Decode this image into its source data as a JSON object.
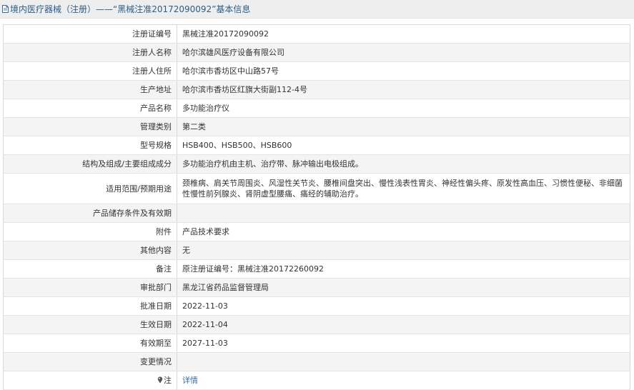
{
  "header": {
    "title": "境内医疗器械（注册）——“黑械注准20172090092”基本信息",
    "icon": "document-icon"
  },
  "rows": [
    {
      "label": "注册证编号",
      "value": "黑械注准20172090092"
    },
    {
      "label": "注册人名称",
      "value": "哈尔滨雄风医疗设备有限公司"
    },
    {
      "label": "注册人住所",
      "value": "哈尔滨市香坊区中山路57号"
    },
    {
      "label": "生产地址",
      "value": "哈尔滨市香坊区红旗大街副112-4号"
    },
    {
      "label": "产品名称",
      "value": "多功能治疗仪"
    },
    {
      "label": "管理类别",
      "value": "第二类"
    },
    {
      "label": "型号规格",
      "value": "HSB400、HSB500、HSB600"
    },
    {
      "label": "结构及组成/主要组成成分",
      "value": "多功能治疗机由主机、治疗带、脉冲输出电极组成。"
    },
    {
      "label": "适用范围/预期用途",
      "value": "颈椎病、肩关节周围炎、风湿性关节炎、腰椎间盘突出、慢性浅表性胃炎、神经性偏头疼、原发性高血压、习惯性便秘、非细菌性慢性前列腺炎、肾阴虚型腰痛、痛经的辅助治疗。"
    },
    {
      "label": "产品储存条件及有效期",
      "value": ""
    },
    {
      "label": "附件",
      "value": "产品技术要求"
    },
    {
      "label": "其他内容",
      "value": "无"
    },
    {
      "label": "备注",
      "value": "原注册证编号：黑械注准20172260092"
    },
    {
      "label": "审批部门",
      "value": "黑龙江省药品监督管理局"
    },
    {
      "label": "批准日期",
      "value": "2022-11-03"
    },
    {
      "label": "生效日期",
      "value": "2022-11-04"
    },
    {
      "label": "有效期至",
      "value": "2027-11-03"
    },
    {
      "label": "变更情况",
      "value": ""
    }
  ],
  "note": {
    "label": "注",
    "icon": "pin-icon",
    "link_text": "详情"
  },
  "colors": {
    "title_text": "#2c5d86",
    "title_bg": "#eeeeee",
    "row_alt_bg": "#f4f4f4",
    "link": "#3a6ea5",
    "border": "#d8d8d8"
  }
}
